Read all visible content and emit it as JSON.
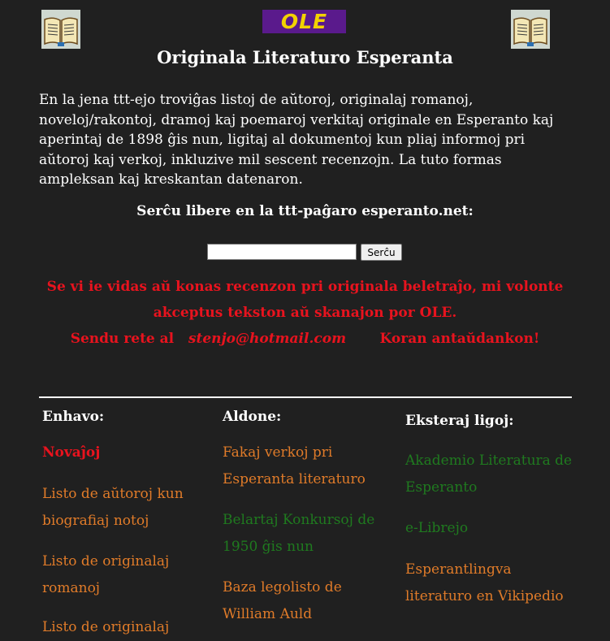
{
  "logo": {
    "text": "OLE"
  },
  "title": "Originala Literaturo Esperanta",
  "intro": "En la jena ttt-ejo troviĝas listoj de aŭtoroj, originalaj romanoj, noveloj/rakontoj, dramoj kaj poemaroj verkitaj originale en Esperanto kaj aperintaj de 1898 ĝis nun, ligitaj al dokumentoj kun pliaj informoj pri aŭtoroj kaj verkoj, inkluzive mil sescent recenzojn. La tuto formas ampleksan kaj kreskantan datenaron.",
  "search": {
    "label": "Serĉu libere en la ttt-paĝaro esperanto.net:",
    "value": "",
    "button": "Serĉu"
  },
  "promo": {
    "line1": "Se vi ie vidas aŭ konas recenzon pri originala beletraĵo, mi volonte",
    "line2": "akceptus tekston aŭ skanajon por OLE.",
    "send": "Sendu rete al",
    "email": "stenjo@hotmail.com",
    "thanks": "Koran antaŭdankon!"
  },
  "columns": {
    "enhavo": {
      "heading": "Enhavo:",
      "links": [
        "Novaĵoj",
        "Listo de aŭtoroj kun biografiaj notoj",
        "Listo de originalaj romanoj",
        "Listo de originalaj"
      ]
    },
    "aldone": {
      "heading": "Aldone:",
      "links": [
        "Fakaj verkoj pri Esperanta literaturo",
        "Belartaj Konkursoj de 1950 ĝis nun",
        "Baza legolisto de William Auld"
      ]
    },
    "ekstere": {
      "heading": "Eksteraj ligoj:",
      "links": [
        "Akademio Literatura de Esperanto",
        "e-Librejo",
        "Esperantlingva literaturo en Vikipedio"
      ]
    }
  },
  "colors": {
    "background": "#202020",
    "promo_red": "#e8131e",
    "link_orange": "#e07b29",
    "link_green": "#1f7a1f",
    "logo_bg": "#5a1a8c",
    "logo_text": "#f2d200"
  }
}
